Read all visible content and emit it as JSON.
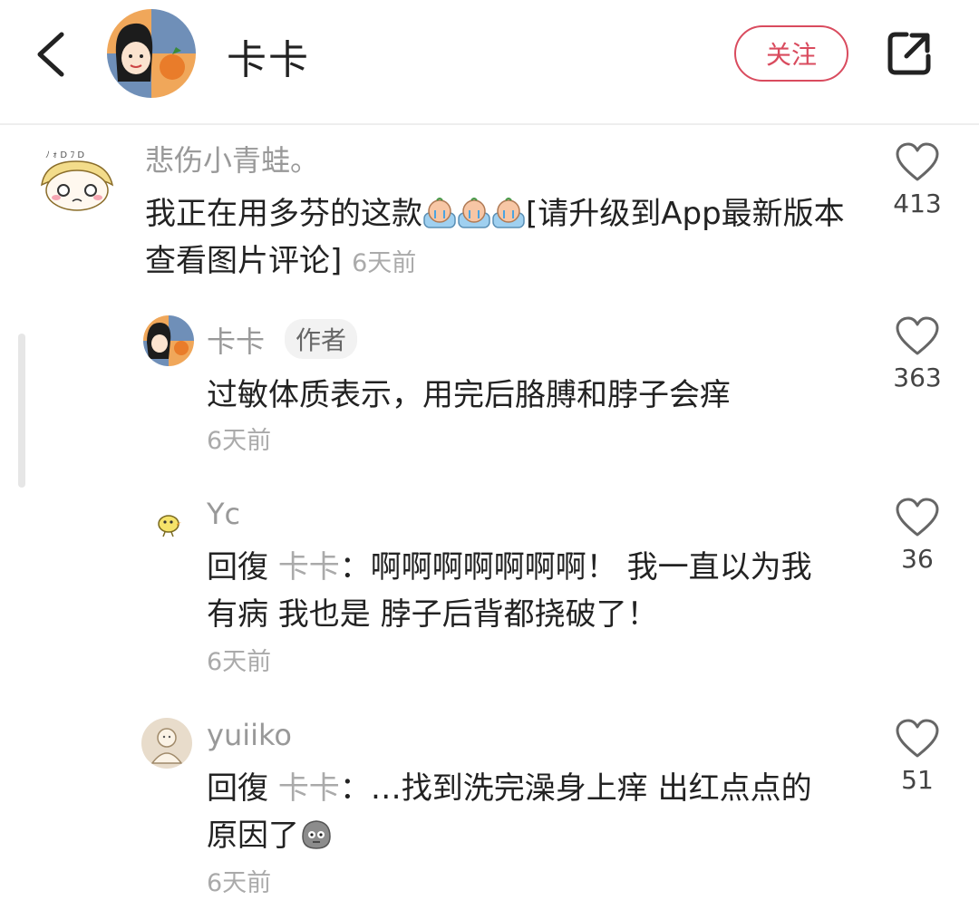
{
  "header": {
    "title": "卡卡",
    "follow_label": "关注"
  },
  "comments": [
    {
      "username": "悲伤小青蛙。",
      "text_before": "我正在用多芬的这款",
      "text_after": "[请升级到App最新版本查看图片评论]",
      "time": "6天前",
      "likes": "413"
    },
    {
      "username": "卡卡",
      "badge": "作者",
      "text": "过敏体质表示，用完后胳膊和脖子会痒",
      "time": "6天前",
      "likes": "363"
    },
    {
      "username": "Yc",
      "reply_label": "回復",
      "reply_target": "卡卡",
      "text": "：啊啊啊啊啊啊啊！ 我一直以为我有病 我也是 脖子后背都挠破了！",
      "time": "6天前",
      "likes": "36"
    },
    {
      "username": "yuiiko",
      "reply_label": "回復",
      "reply_target": "卡卡",
      "text": "：…找到洗完澡身上痒 出红点点的原因了",
      "time": "6天前",
      "likes": "51"
    }
  ]
}
